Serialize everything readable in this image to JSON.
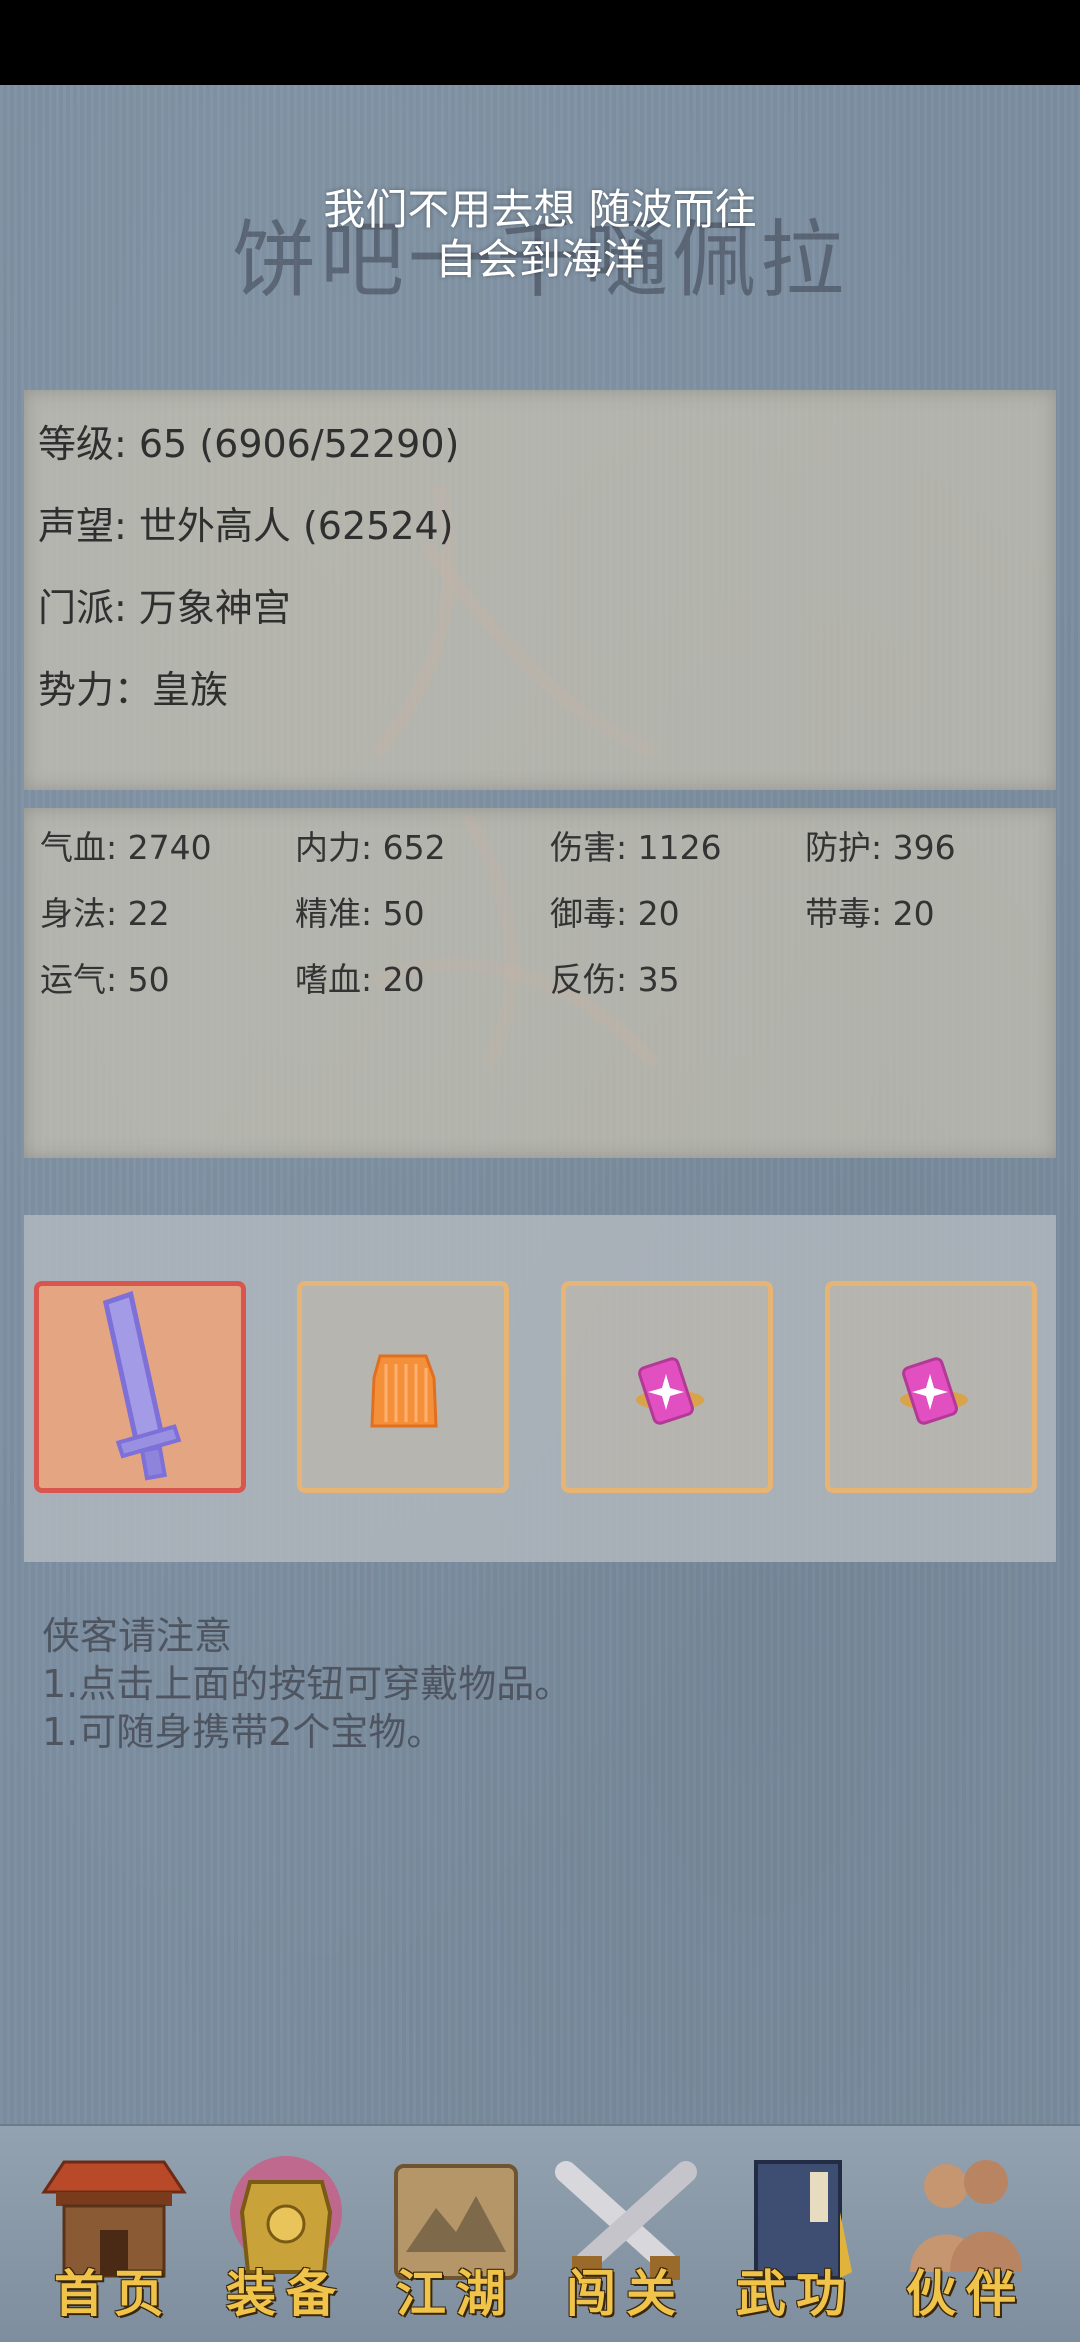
{
  "header": {
    "title_shadow": "饼吧一千嗵佩拉",
    "lyric_line1": "我们不用去想 随波而往",
    "lyric_line2": "自会到海洋"
  },
  "profile": {
    "level": "等级: 65 (6906/52290)",
    "reputation": "声望: 世外高人 (62524)",
    "sect": "门派: 万象神宫",
    "faction": "势力：皇族"
  },
  "stats": [
    "气血: 2740",
    "内力: 652",
    "伤害: 1126",
    "防护: 396",
    "身法: 22",
    "精准: 50",
    "御毒: 20",
    "带毒: 20",
    "运气: 50",
    "嗜血: 20",
    "反伤: 35"
  ],
  "equipment": {
    "slots": [
      {
        "icon": "sword-icon",
        "selected": true
      },
      {
        "icon": "armor-icon",
        "selected": false
      },
      {
        "icon": "treasure-icon",
        "selected": false
      },
      {
        "icon": "treasure-icon",
        "selected": false
      }
    ]
  },
  "notice": {
    "title": "侠客请注意",
    "line1": "1.点击上面的按钮可穿戴物品。",
    "line2": "1.可随身携带2个宝物。"
  },
  "nav": {
    "home": "首页",
    "equip": "装备",
    "jianghu": "江湖",
    "challenge": "闯关",
    "martial": "武功",
    "partner": "伙伴"
  },
  "colors": {
    "background": "#7b8ea0",
    "panel": "#c8c2b2",
    "slot_border": "#e8b473",
    "slot_selected_border": "#d9564f",
    "nav_text": "#f0c34a"
  }
}
